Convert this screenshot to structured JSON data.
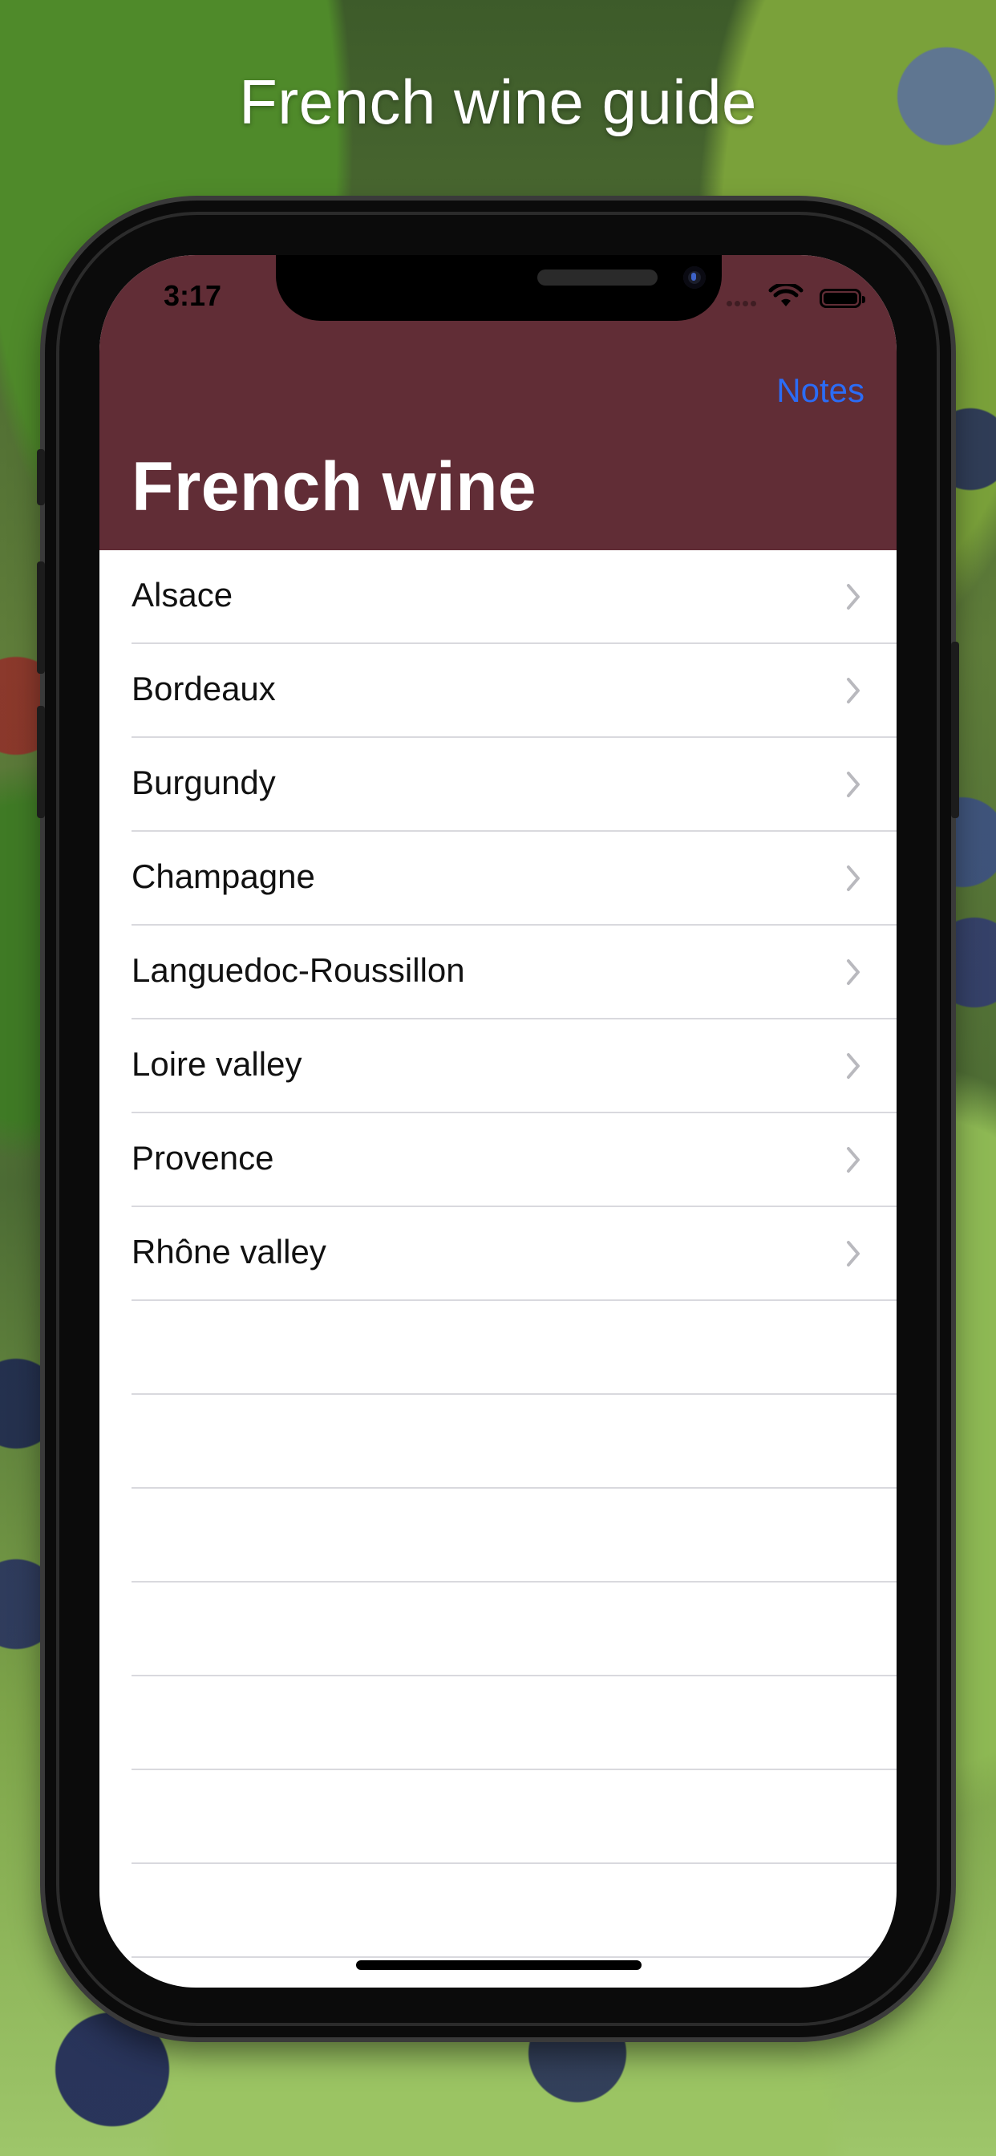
{
  "promo": {
    "title": "French wine guide"
  },
  "status_bar": {
    "time": "3:17"
  },
  "nav": {
    "right_button": "Notes",
    "large_title": "French wine"
  },
  "regions": [
    {
      "label": "Alsace"
    },
    {
      "label": "Bordeaux"
    },
    {
      "label": "Burgundy"
    },
    {
      "label": "Champagne"
    },
    {
      "label": "Languedoc-Roussillon"
    },
    {
      "label": "Loire valley"
    },
    {
      "label": "Provence"
    },
    {
      "label": "Rhône valley"
    }
  ],
  "colors": {
    "header_bg": "#612d36",
    "accent": "#2b6cf6",
    "separator": "#d9d9de"
  },
  "icons": {
    "row_disclosure": "chevron-right-icon",
    "status": [
      "wifi-icon",
      "battery-icon"
    ]
  }
}
